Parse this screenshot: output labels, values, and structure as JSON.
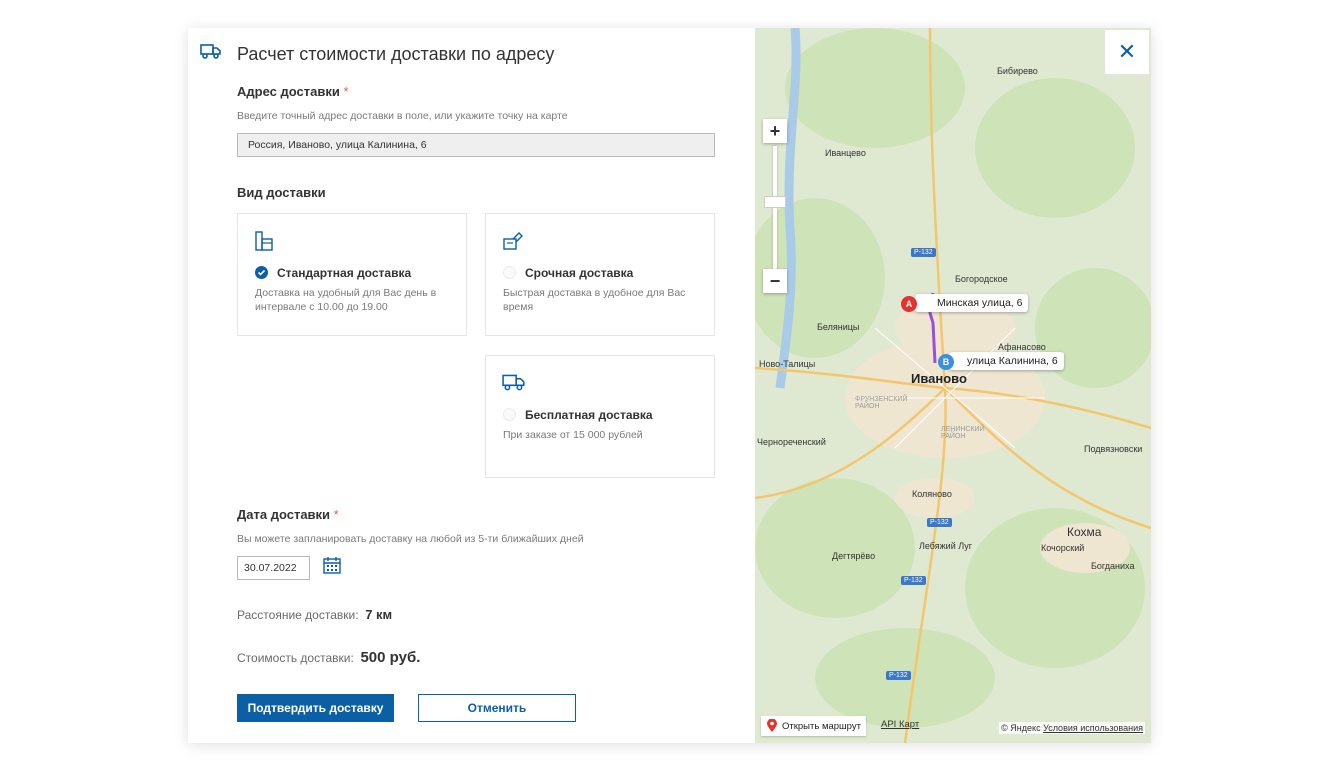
{
  "header": {
    "title": "Расчет стоимости доставки по адресу"
  },
  "address": {
    "label": "Адрес доставки",
    "required_mark": "*",
    "hint": "Введите точный адрес доставки в поле, или укажите точку на карте",
    "value": "Россия, Иваново, улица Калинина, 6"
  },
  "delivery_type": {
    "label": "Вид доставки",
    "options": [
      {
        "title": "Стандартная доставка",
        "desc": "Доставка на удобный для Вас день в интервале с 10.00 до 19.00",
        "selected": true,
        "icon": "building-box-icon"
      },
      {
        "title": "Срочная доставка",
        "desc": "Быстрая доставка в удобное для Вас время",
        "selected": false,
        "icon": "box-pour-icon"
      },
      {
        "title": "Бесплатная доставка",
        "desc": "При заказе от 15 000 рублей",
        "selected": false,
        "icon": "truck-icon"
      }
    ]
  },
  "date": {
    "label": "Дата доставки",
    "required_mark": "*",
    "hint": "Вы можете запланировать доставку на любой из 5-ти ближайших дней",
    "value": "30.07.2022"
  },
  "summary": {
    "distance_label": "Расстояние доставки:",
    "distance_value": "7 км",
    "cost_label": "Стоимость доставки:",
    "cost_value": "500 руб."
  },
  "buttons": {
    "confirm": "Подтвердить доставку",
    "cancel": "Отменить"
  },
  "map": {
    "close": "✕",
    "zoom_in": "+",
    "zoom_out": "−",
    "places": {
      "bibirevo": "Бибирево",
      "ivantsevo": "Иванцево",
      "bogorodskoe": "Богородское",
      "belyanitsy": "Беляницы",
      "afanasovo": "Афанасово",
      "novo_talitsy": "Ново-Талицы",
      "ivanovo": "Иваново",
      "frunzensky": "ФРУНЗЕНСКИЙ РАЙОН",
      "leninsky": "ЛЕНИНСКИЙ РАЙОН",
      "chernorechensky": "Чернореченский",
      "podvyaznovsky": "Подвязновски",
      "kolyanovo": "Коляново",
      "kokhma": "Кохма",
      "kokhorsky": "Кочорский",
      "lebyazhiy": "Лебяжий Луг",
      "degtyarevo": "Дегтярёво",
      "bogdanikha": "Богданиха"
    },
    "road_code": "Р-132",
    "point_a": {
      "letter": "A",
      "label": "Минская улица, 6"
    },
    "point_b": {
      "letter": "B",
      "label": "улица Калинина, 6"
    },
    "open_route": "Открыть маршрут",
    "api": "API Карт",
    "copyright": "© Яндекс",
    "terms": "Условия использования"
  },
  "colors": {
    "accent": "#0b5fa4",
    "required": "#e55b4d",
    "pin_a": "#e5322d",
    "pin_b": "#3b8fe0",
    "route": "#9b4fd6"
  }
}
